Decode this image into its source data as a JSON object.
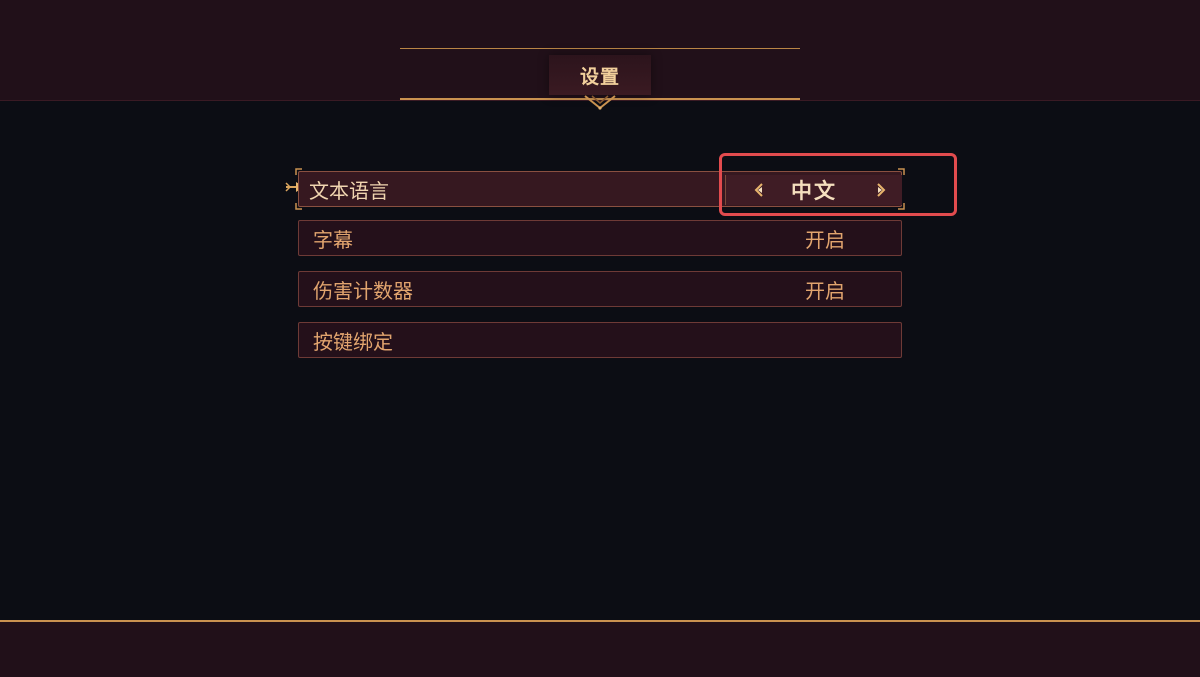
{
  "header": {
    "title": "设置"
  },
  "settings": {
    "rows": [
      {
        "label": "文本语言",
        "value": "中文",
        "selected": true
      },
      {
        "label": "字幕",
        "value": "开启"
      },
      {
        "label": "伤害计数器",
        "value": "开启"
      },
      {
        "label": "按键绑定",
        "value": ""
      }
    ]
  },
  "icons": {
    "pointer": "pointer-icon",
    "left_arrow": "arrow-left-icon",
    "right_arrow": "arrow-right-icon",
    "ornament": "title-ornament-icon"
  },
  "colors": {
    "background": "#0c0d14",
    "bar": "#211019",
    "gold": "#c99250",
    "text": "#e1a46e",
    "selected_text": "#f1d5b0",
    "highlight": "#e24b4e"
  }
}
